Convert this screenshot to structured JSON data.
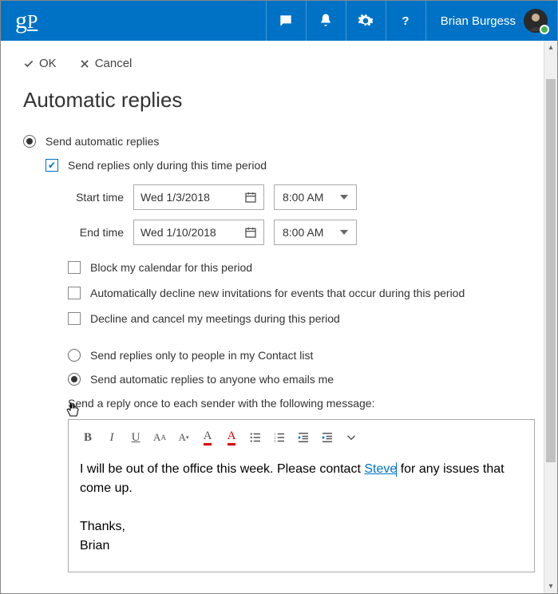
{
  "header": {
    "logo": "gP",
    "userName": "Brian Burgess"
  },
  "actions": {
    "ok": "OK",
    "cancel": "Cancel"
  },
  "title": "Automatic replies",
  "sendReplies": {
    "label": "Send automatic replies",
    "timePeriodLabel": "Send replies only during this time period",
    "startLabel": "Start time",
    "startDate": "Wed 1/3/2018",
    "startTime": "8:00 AM",
    "endLabel": "End time",
    "endDate": "Wed 1/10/2018",
    "endTime": "8:00 AM"
  },
  "options": {
    "block": "Block my calendar for this period",
    "decline": "Automatically decline new invitations for events that occur during this period",
    "cancel": "Decline and cancel my meetings during this period"
  },
  "recipients": {
    "contactsOnly": "Send replies only to people in my Contact list",
    "anyone": "Send automatic replies to anyone who emails me",
    "desc": "Send a reply once to each sender with the following message:"
  },
  "message": {
    "part1": "I will be out of the office this week. Please contact ",
    "link": "Steve",
    "part2": " for any issues that come up.",
    "thanks": "Thanks,",
    "sign": "Brian"
  }
}
